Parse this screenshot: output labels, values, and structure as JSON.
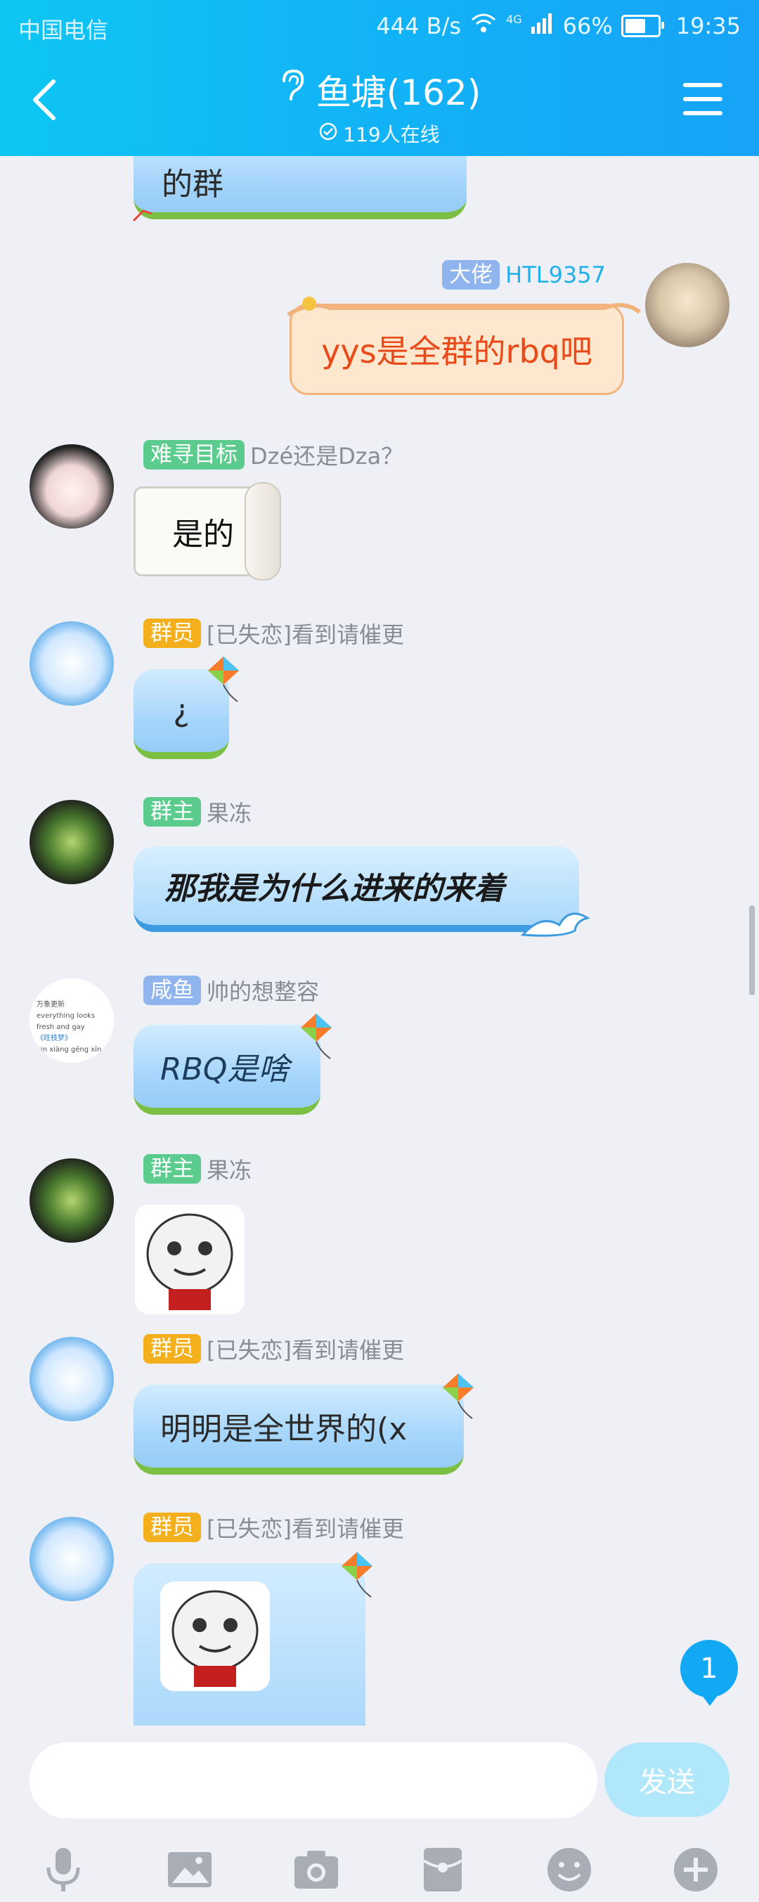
{
  "status_bar": {
    "carrier": "中国电信",
    "speed": "444 B/s",
    "network": "4G",
    "battery": "66%",
    "time": "19:35"
  },
  "header": {
    "title": "鱼塘(162)",
    "online": "119人在线"
  },
  "messages": [
    {
      "bubble_text": "的群"
    },
    {
      "tag": "大佬",
      "name": "HTL9357",
      "text": "yys是全群的rbq吧"
    },
    {
      "tag": "难寻目标",
      "name": "Dzé还是Dza？",
      "text": "是的"
    },
    {
      "tag": "群员",
      "name": "[已失恋]看到请催更",
      "text": "¿"
    },
    {
      "tag": "群主",
      "name": "果冻",
      "text": "那我是为什么进来的来着"
    },
    {
      "tag": "咸鱼",
      "name": "帅的想整容",
      "text": "RBQ是啥"
    },
    {
      "tag": "群主",
      "name": "果冻",
      "text": ""
    },
    {
      "tag": "群员",
      "name": "[已失恋]看到请催更",
      "text": "明明是全世界的(x"
    },
    {
      "tag": "群员",
      "name": "[已失恋]看到请催更",
      "text": ""
    }
  ],
  "avatar_texts": [
    "万象更新",
    "everything looks fresh and gay",
    "《旺枝梦》",
    "xin xiàng gēng xīn"
  ],
  "colors": {
    "tag_green": "#5ccc8e",
    "tag_orange": "#f3b01c",
    "tag_blue": "#8fb4ee",
    "accent": "#12a8f4"
  },
  "new_message_count": "1",
  "input": {
    "placeholder": "",
    "send_label": "发送"
  },
  "toolbar": [
    "mic-icon",
    "image-icon",
    "camera-icon",
    "red-packet-icon",
    "emoji-icon",
    "plus-icon"
  ]
}
